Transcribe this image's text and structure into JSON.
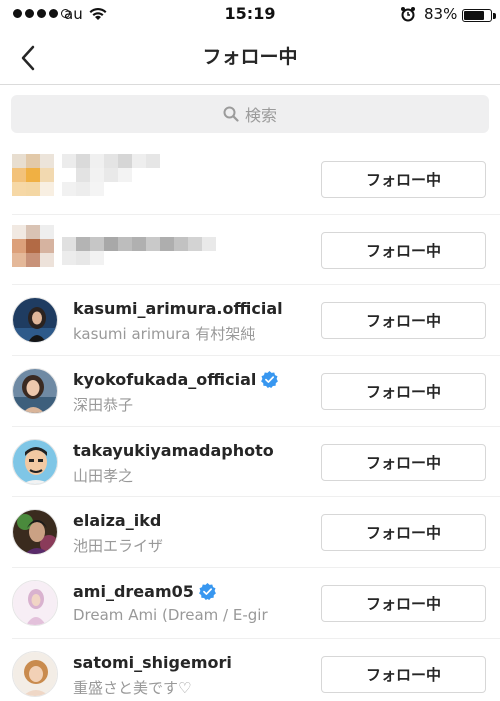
{
  "status_bar": {
    "carrier": "au",
    "time": "15:19",
    "battery": "83%",
    "battery_level": 0.83,
    "signal_bars_filled": 4,
    "signal_bars_total": 5
  },
  "nav": {
    "title": "フォロー中",
    "back_icon": "chevron-left-icon"
  },
  "search": {
    "placeholder": "検索",
    "icon": "search-icon"
  },
  "list": {
    "button_label": "フォロー中",
    "rows": [
      {
        "username": "",
        "fullname": "",
        "blurred": true
      },
      {
        "username": "",
        "fullname": "",
        "blurred": true
      },
      {
        "username": "kasumi_arimura.official",
        "fullname": "kasumi arimura 有村架純",
        "verified": false
      },
      {
        "username": "kyokofukada_official",
        "fullname": "深田恭子",
        "verified": true
      },
      {
        "username": "takayukiyamadaphoto",
        "fullname": "山田孝之",
        "verified": false
      },
      {
        "username": "elaiza_ikd",
        "fullname": "池田エライザ",
        "verified": false
      },
      {
        "username": "ami_dream05",
        "fullname": "Dream Ami (Dream / E-gir",
        "verified": true
      },
      {
        "username": "satomi_shigemori",
        "fullname": "重盛さと美です♡",
        "verified": false
      }
    ]
  },
  "colors": {
    "verified": "#3897f0",
    "secondary_text": "#999999",
    "button_border": "#d7d7d7"
  }
}
